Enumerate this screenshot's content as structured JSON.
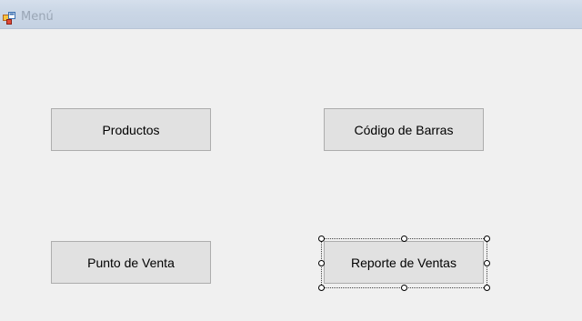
{
  "window": {
    "title": "Menú",
    "icon": "form-icon"
  },
  "buttons": {
    "productos": "Productos",
    "codigo_barras": "Código de Barras",
    "punto_venta": "Punto de Venta",
    "reporte_ventas": "Reporte de Ventas"
  },
  "colors": {
    "background": "#f0f0f0",
    "button_face": "#e1e1e1",
    "button_border": "#adadad",
    "titlebar": "#cbd7e6"
  }
}
